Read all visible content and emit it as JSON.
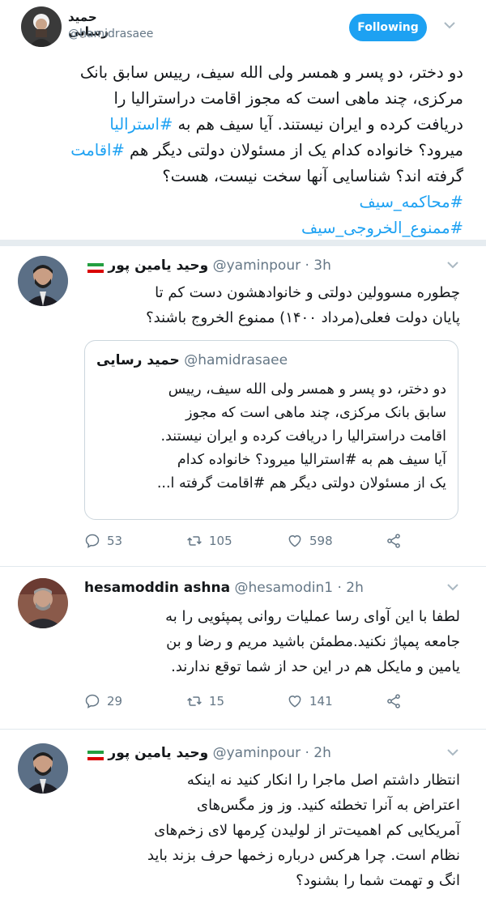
{
  "header": {
    "name": "حمید رسایی",
    "handle": "@hamidrasaee",
    "follow_label": "Following"
  },
  "main_tweet": {
    "line1": "دو دختر، دو پسر و همسر ولی الله سیف، رییس سابق بانک",
    "line2": "مرکزی، چند ماهی است که مجوز اقامت دراسترالیا را",
    "line3_a": "دریافت کرده و ایران نیستند. آیا سیف هم به ",
    "line3_tag": "#استرالیا",
    "line4_a": "میرود؟ خانواده کدام یک از مسئولان دولتی دیگر هم ",
    "line4_tag": "#اقامت",
    "line5": "گرفته اند؟ شناسایی آنها سخت نیست، هست؟",
    "tag1": "#محاکمه_سیف",
    "tag2": "#ممنوع_الخروجی_سیف"
  },
  "reply1": {
    "name": "وحید یامین پور",
    "handle": "@yaminpour · 3h",
    "line1": "چطوره مسوولین دولتی و خانوادهشون دست کم تا",
    "line2": "پایان دولت فعلی(مرداد ۱۴۰۰) ممنوع الخروج باشند؟",
    "quote": {
      "name": "حمید رسایی",
      "handle": "@hamidrasaee",
      "line1": "دو دختر، دو پسر و همسر ولی الله سیف، رییس",
      "line2": "سابق بانک مرکزی، چند ماهی است که مجوز",
      "line3": "اقامت دراسترالیا را دریافت کرده و ایران نیستند.",
      "line4": "آیا سیف هم به #استرالیا میرود؟ خانواده کدام",
      "line5": "یک از مسئولان دولتی دیگر هم #اقامت گرفته ا..."
    },
    "replies": "53",
    "retweets": "105",
    "likes": "598"
  },
  "reply2": {
    "name": "hesamoddin ashna",
    "handle": "@hesamodin1 · 2h",
    "line1": "لطفا با این آوای رسا عملیات روانی پمپئویی را  به",
    "line2": "جامعه پمپاژ نکنید.مطمئن باشید مریم و رضا و بن",
    "line3": "یامین و مایکل هم در این حد از شما توقع ندارند.",
    "replies": "29",
    "retweets": "15",
    "likes": "141"
  },
  "reply3": {
    "name": "وحید یامین پور",
    "handle": "@yaminpour · 2h",
    "line1": "انتظار داشتم اصل ماجرا را انکار کنید نه اینکه",
    "line2": "اعتراض به آنرا تخطئه کنید. وز وز مگس‌های",
    "line3": "آمریکایی کم اهمیت‌تر از لولیدن کِرمها لای زخم‌های",
    "line4": "نظام است. چرا هرکس درباره زخمها حرف بزند باید",
    "line5": "انگ و تهمت شما را بشنود؟"
  },
  "colors": {
    "accent": "#1da1f2",
    "muted": "#657786",
    "separator": "#e6ecf0"
  },
  "icons": [
    "reply-icon",
    "retweet-icon",
    "like-icon",
    "share-icon",
    "chevron-down-icon",
    "iran-flag-icon"
  ]
}
